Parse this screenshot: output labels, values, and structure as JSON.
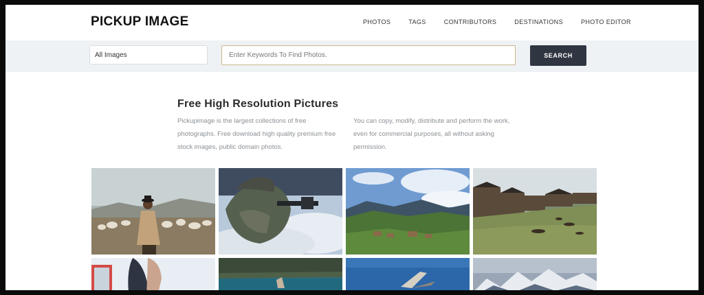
{
  "header": {
    "logo": "PICKUP IMAGE",
    "nav": [
      "PHOTOS",
      "TAGS",
      "CONTRIBUTORS",
      "DESTINATIONS",
      "PHOTO EDITOR"
    ]
  },
  "search": {
    "category_selected": "All Images",
    "placeholder": "Enter Keywords To Find Photos.",
    "button_label": "SEARCH"
  },
  "intro": {
    "title": "Free High Resolution Pictures",
    "left_text": "Pickupimage is the largest collections of free photographs. Free download high quality premium free stock images, public domain photos.",
    "right_text": "You can copy, modify, distribute and perform the work, even for commercial purposes, all without asking permission."
  }
}
